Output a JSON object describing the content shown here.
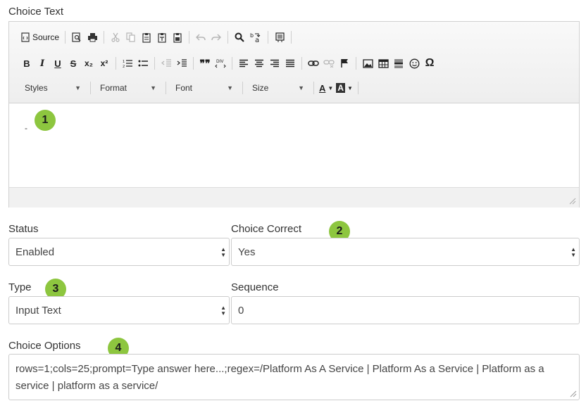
{
  "choice_text": {
    "label": "Choice Text",
    "toolbar": {
      "row1": {
        "source_label": "Source"
      },
      "row3": {
        "styles": "Styles",
        "format": "Format",
        "font": "Font",
        "size": "Size"
      },
      "glyphs": {
        "bold": "B",
        "italic": "I",
        "underline": "U",
        "strike": "S",
        "subscript": "x₂",
        "superscript": "x²",
        "omega": "Ω",
        "blockquote": "❞❞",
        "text_color": "A",
        "bg_color": "A"
      }
    },
    "content": "-"
  },
  "status": {
    "label": "Status",
    "value": "Enabled"
  },
  "choice_correct": {
    "label": "Choice Correct",
    "value": "Yes"
  },
  "type": {
    "label": "Type",
    "value": "Input Text"
  },
  "sequence": {
    "label": "Sequence",
    "value": "0"
  },
  "choice_options": {
    "label": "Choice Options",
    "value": "rows=1;cols=25;prompt=Type answer here...;regex=/Platform As A Service | Platform As a Service | Platform as a service | platform as a service/"
  },
  "badges": [
    "1",
    "2",
    "3",
    "4"
  ],
  "colors": {
    "badge": "#8dc63f",
    "border": "#cccccc",
    "toolbar": "#f4f4f4"
  }
}
